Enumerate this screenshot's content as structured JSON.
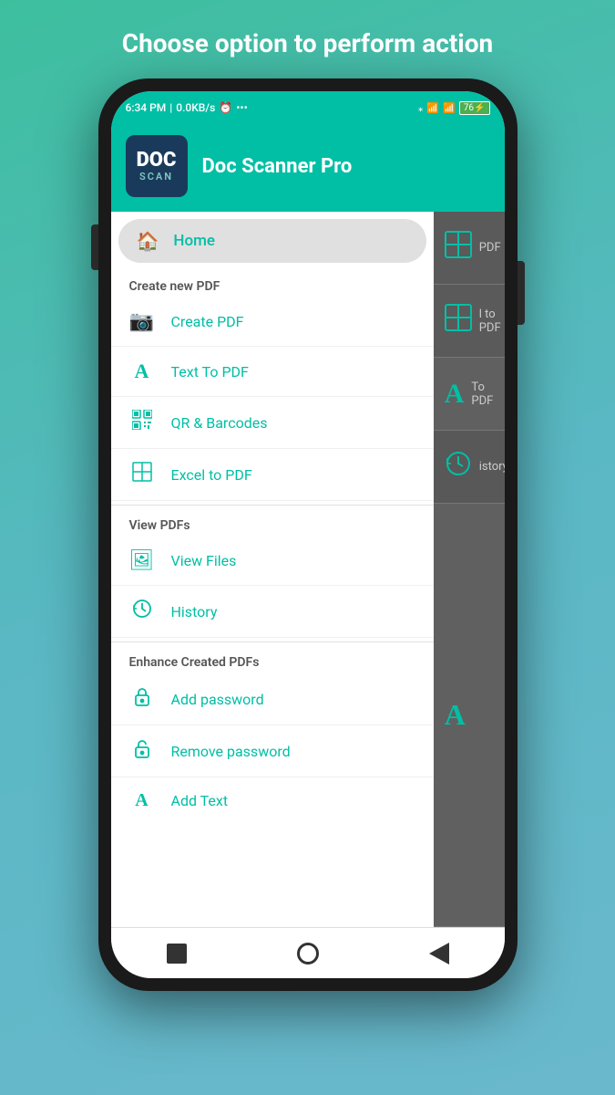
{
  "page": {
    "top_title": "Choose option to perform action"
  },
  "status_bar": {
    "time": "6:34 PM",
    "speed": "0.0KB/s",
    "battery": "76",
    "charging": "⚡"
  },
  "app_header": {
    "logo_top": "DOC",
    "logo_bottom": "SCAN",
    "title": "Doc Scanner Pro"
  },
  "home_item": {
    "label": "Home"
  },
  "sections": [
    {
      "label": "Create new PDF",
      "items": [
        {
          "icon": "📷",
          "text": "Create PDF"
        },
        {
          "icon": "A",
          "text": "Text To PDF"
        },
        {
          "icon": "▦",
          "text": "QR & Barcodes"
        },
        {
          "icon": "⊞",
          "text": "Excel to PDF"
        }
      ]
    },
    {
      "label": "View PDFs",
      "items": [
        {
          "icon": "🖼",
          "text": "View Files"
        },
        {
          "icon": "🕐",
          "text": "History"
        }
      ]
    },
    {
      "label": "Enhance Created PDFs",
      "items": [
        {
          "icon": "🔒",
          "text": "Add password"
        },
        {
          "icon": "🔓",
          "text": "Remove password"
        },
        {
          "icon": "A",
          "text": "Add Text"
        }
      ]
    }
  ],
  "right_panel_items": [
    {
      "icon": "⊞",
      "text": "PDF"
    },
    {
      "icon": "⊞",
      "text": "l to PDF"
    },
    {
      "icon": "A",
      "text": "To PDF"
    },
    {
      "icon": "🕐",
      "text": "istory"
    },
    {
      "icon": "A",
      "text": ""
    }
  ],
  "bottom_nav": {
    "square_label": "recent",
    "circle_label": "home",
    "triangle_label": "back"
  }
}
